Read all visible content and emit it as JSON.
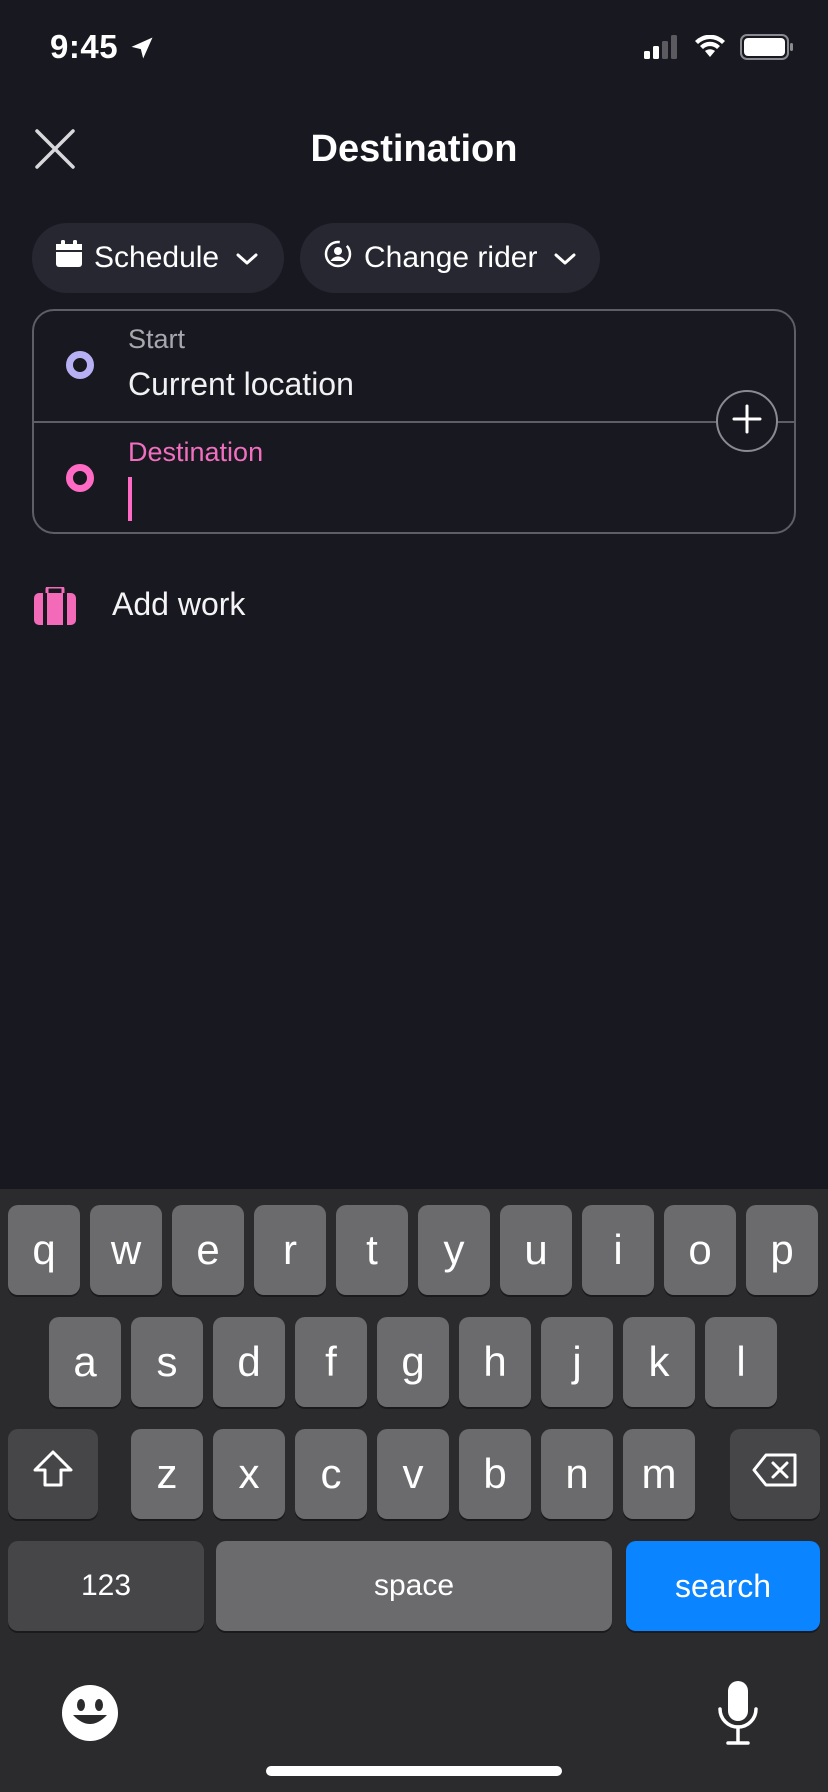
{
  "status_bar": {
    "time": "9:45",
    "icons": [
      "location-arrow-icon",
      "signal-icon",
      "wifi-icon",
      "battery-icon"
    ]
  },
  "header": {
    "title": "Destination",
    "close_icon": "close-icon"
  },
  "chips": {
    "schedule": {
      "label": "Schedule",
      "icon": "calendar-icon"
    },
    "change_rider": {
      "label": "Change rider",
      "icon": "rider-icon"
    }
  },
  "route": {
    "start_label": "Start",
    "start_value": "Current location",
    "destination_label": "Destination",
    "destination_value": "",
    "add_stop_icon": "plus-icon"
  },
  "shortcuts": [
    {
      "label": "Add work",
      "icon": "briefcase-icon"
    }
  ],
  "keyboard": {
    "row1": [
      "q",
      "w",
      "e",
      "r",
      "t",
      "y",
      "u",
      "i",
      "o",
      "p"
    ],
    "row2": [
      "a",
      "s",
      "d",
      "f",
      "g",
      "h",
      "j",
      "k",
      "l"
    ],
    "row3": [
      "z",
      "x",
      "c",
      "v",
      "b",
      "n",
      "m"
    ],
    "numbers_key": "123",
    "space_key": "space",
    "search_key": "search"
  },
  "colors": {
    "background": "#181820",
    "accent_pink": "#ff6bc4",
    "start_purple": "#b8b0f5",
    "search_blue": "#0a84ff"
  }
}
